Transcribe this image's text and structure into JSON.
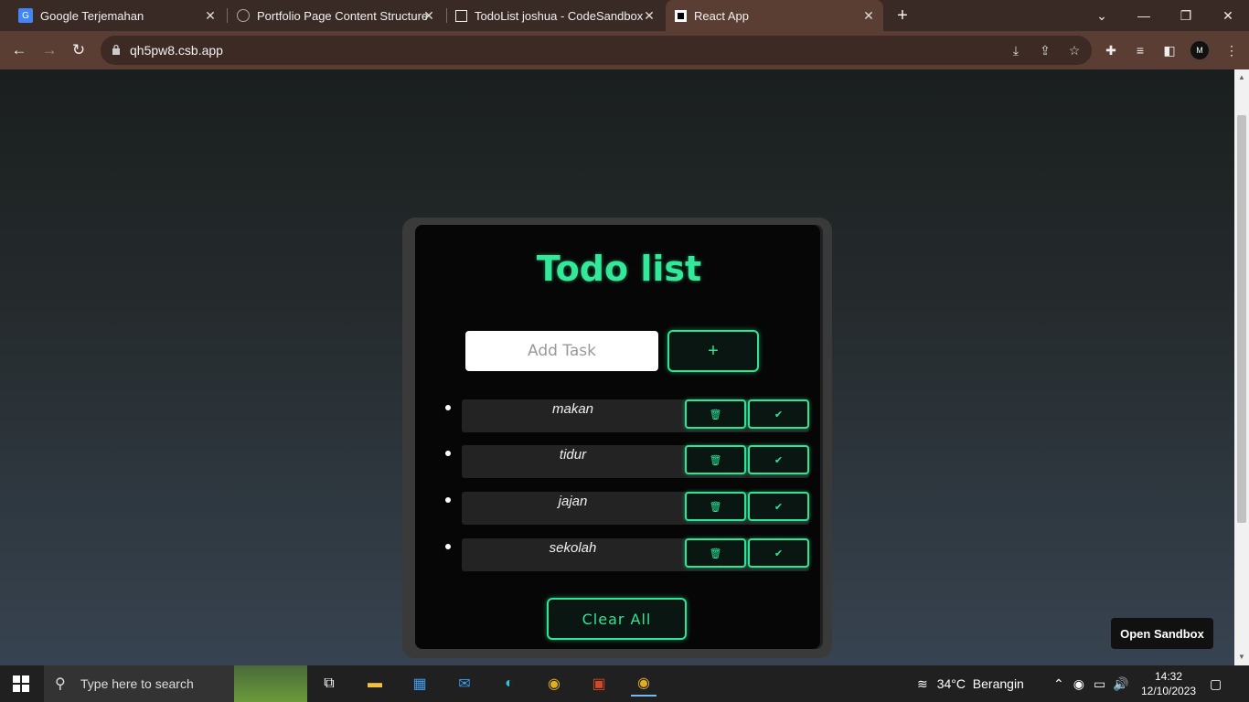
{
  "browser": {
    "tabs": [
      {
        "title": "Google Terjemahan",
        "favicon": "google-translate-icon"
      },
      {
        "title": "Portfolio Page Content Structure",
        "favicon": "chatgpt-icon"
      },
      {
        "title": "TodoList joshua - CodeSandbox",
        "favicon": "codesandbox-icon"
      },
      {
        "title": "React App",
        "favicon": "react-app-icon"
      }
    ],
    "url": "qh5pw8.csb.app",
    "profile_initial": "M"
  },
  "app": {
    "title": "Todo list",
    "input_placeholder": "Add Task",
    "add_label": "+",
    "tasks": [
      {
        "name": "makan",
        "delete_icon": "🗑",
        "done_icon": "✔"
      },
      {
        "name": "tidur",
        "delete_icon": "🗑",
        "done_icon": "✔"
      },
      {
        "name": "jajan",
        "delete_icon": "🗑",
        "done_icon": "✔"
      },
      {
        "name": "sekolah",
        "delete_icon": "🗑",
        "done_icon": "✔"
      }
    ],
    "clear_label": "Clear All",
    "accent_color": "#2de596"
  },
  "sandbox": {
    "open_label": "Open Sandbox"
  },
  "taskbar": {
    "search_placeholder": "Type here to search",
    "weather": "34°C  Berangin",
    "time": "14:32",
    "date": "12/10/2023"
  }
}
